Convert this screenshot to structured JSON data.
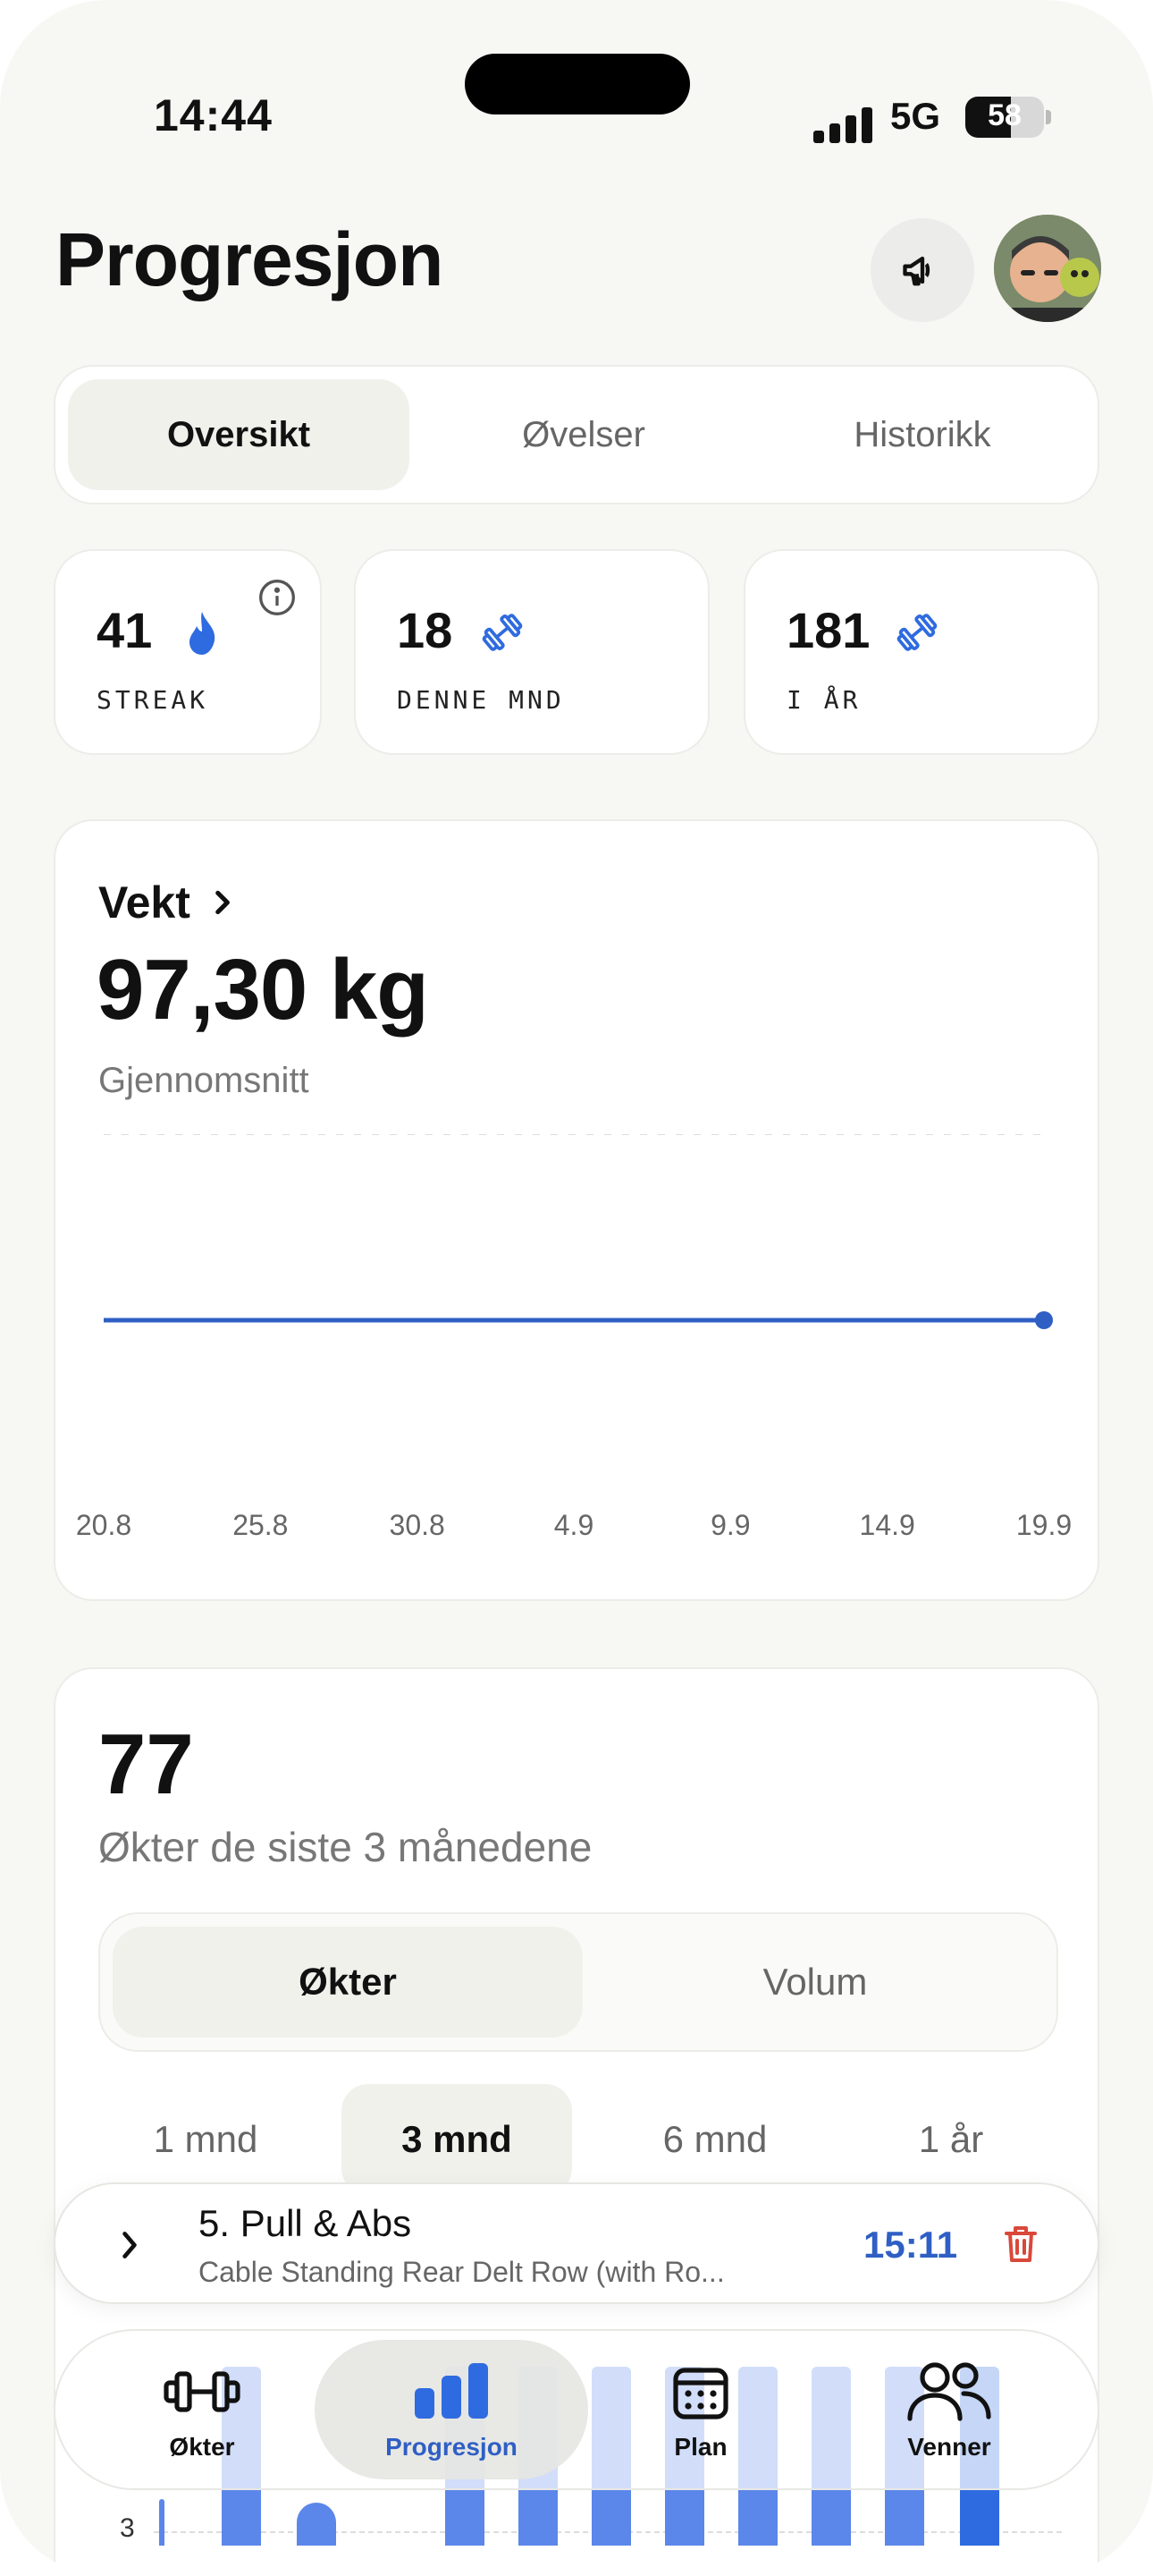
{
  "status": {
    "time": "14:44",
    "network": "5G",
    "battery": "58",
    "battery_level": 0.58
  },
  "header": {
    "title": "Progresjon",
    "announce_icon": "megaphone-icon",
    "avatar": "user-avatar"
  },
  "tabs": [
    {
      "label": "Oversikt",
      "active": true
    },
    {
      "label": "Øvelser",
      "active": false
    },
    {
      "label": "Historikk",
      "active": false
    }
  ],
  "stats": [
    {
      "value": "41",
      "label": "STREAK",
      "icon": "flame-icon"
    },
    {
      "value": "18",
      "label": "DENNE MND",
      "icon": "dumbbell-icon"
    },
    {
      "value": "181",
      "label": "I ÅR",
      "icon": "dumbbell-icon"
    }
  ],
  "weight": {
    "heading": "Vekt",
    "value": "97,30 kg",
    "subtitle": "Gjennomsnitt"
  },
  "chart_data": {
    "type": "line",
    "x": [
      "20.8",
      "25.8",
      "30.8",
      "4.9",
      "9.9",
      "14.9",
      "19.9"
    ],
    "series": [
      {
        "values": [
          97.3,
          97.3,
          97.3,
          97.3,
          97.3,
          97.3,
          97.3
        ]
      }
    ],
    "color": "#2f5fc4",
    "grid": true
  },
  "sessions": {
    "count": "77",
    "subtitle": "Økter de siste 3 månedene",
    "mode_tabs": [
      {
        "label": "Økter",
        "active": true
      },
      {
        "label": "Volum",
        "active": false
      }
    ],
    "ranges": [
      {
        "label": "1 mnd",
        "active": false
      },
      {
        "label": "3 mnd",
        "active": true
      },
      {
        "label": "6 mnd",
        "active": false
      },
      {
        "label": "1 år",
        "active": false
      }
    ],
    "y_tick": "3"
  },
  "active_workout": {
    "title": "5. Pull & Abs",
    "exercise": "Cable Standing Rear Delt Row (with Ro...",
    "timer": "15:11",
    "timer_color": "#2f5fc4",
    "delete_color": "#d9483b"
  },
  "nav": [
    {
      "label": "Økter",
      "icon": "dumbbell-icon",
      "active": false
    },
    {
      "label": "Progresjon",
      "icon": "bar-chart-icon",
      "active": true
    },
    {
      "label": "Plan",
      "icon": "calendar-icon",
      "active": false
    },
    {
      "label": "Venner",
      "icon": "friends-icon",
      "active": false
    }
  ]
}
